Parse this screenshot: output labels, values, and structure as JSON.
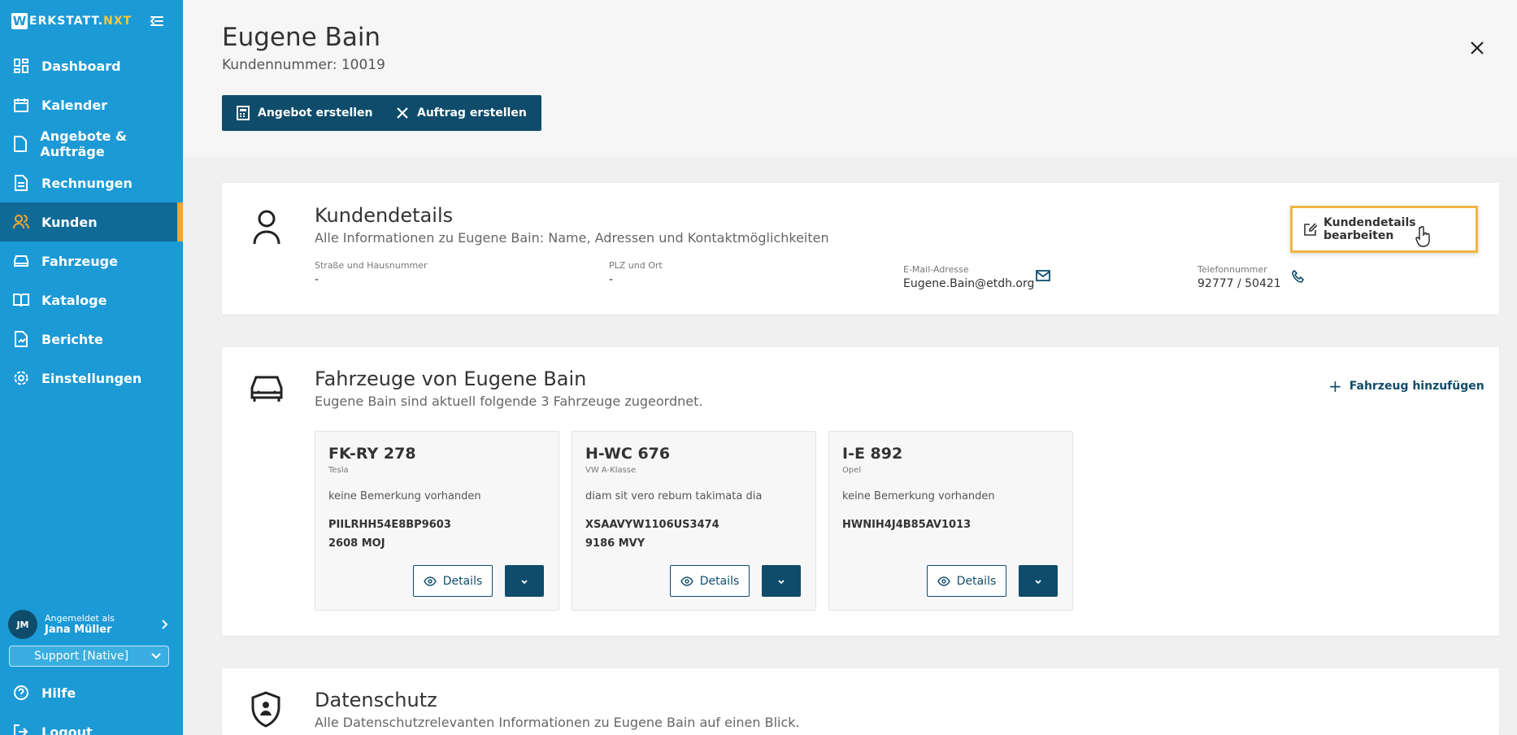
{
  "brand": {
    "w": "W",
    "text": "ERKSTATT.",
    "nxt": "NXT"
  },
  "nav": {
    "items": [
      {
        "label": "Dashboard",
        "icon": "dashboard-icon"
      },
      {
        "label": "Kalender",
        "icon": "calendar-icon"
      },
      {
        "label": "Angebote & Aufträge",
        "icon": "document-icon"
      },
      {
        "label": "Rechnungen",
        "icon": "invoice-icon"
      },
      {
        "label": "Kunden",
        "icon": "users-icon",
        "active": true
      },
      {
        "label": "Fahrzeuge",
        "icon": "car-icon"
      },
      {
        "label": "Kataloge",
        "icon": "book-icon"
      },
      {
        "label": "Berichte",
        "icon": "report-icon"
      },
      {
        "label": "Einstellungen",
        "icon": "gear-icon"
      }
    ],
    "bottom": [
      {
        "label": "Hilfe",
        "icon": "help-icon"
      },
      {
        "label": "Logout",
        "icon": "logout-icon"
      }
    ]
  },
  "user": {
    "initials": "JM",
    "logged_in_as": "Angemeldet als",
    "name": "Jana Müller",
    "role": "Support [Native]"
  },
  "header": {
    "customer_name": "Eugene Bain",
    "customer_number": "Kundennummer: 10019",
    "btn_offer": "Angebot erstellen",
    "btn_order": "Auftrag erstellen"
  },
  "customer_details": {
    "title": "Kundendetails",
    "subtitle": "Alle Informationen zu Eugene Bain: Name, Adressen und Kontaktmöglichkeiten",
    "edit_label": "Kundendetails bearbeiten",
    "street_label": "Straße und Hausnummer",
    "street_value": "-",
    "city_label": "PLZ und Ort",
    "city_value": "-",
    "email_label": "E-Mail-Adresse",
    "email_value": "Eugene.Bain@etdh.org",
    "phone_label": "Telefonnummer",
    "phone_value": "92777 / 50421"
  },
  "vehicles": {
    "title": "Fahrzeuge von Eugene Bain",
    "subtitle": "Eugene Bain sind aktuell folgende 3 Fahrzeuge zugeordnet.",
    "add_label": "Fahrzeug hinzufügen",
    "details_label": "Details",
    "items": [
      {
        "plate": "FK-RY 278",
        "model": "Tesla",
        "remark": "keine Bemerkung vorhanden",
        "vin": "PIILRHH54E8BP9603",
        "kba": "2608 MOJ"
      },
      {
        "plate": "H-WC 676",
        "model": "VW A-Klasse",
        "remark": "diam sit vero rebum takimata dia",
        "vin": "XSAAVYW1106US3474",
        "kba": "9186 MVY"
      },
      {
        "plate": "I-E 892",
        "model": "Opel",
        "remark": "keine Bemerkung vorhanden",
        "vin": "HWNIH4J4B85AV1013",
        "kba": ""
      }
    ]
  },
  "privacy": {
    "title": "Datenschutz",
    "subtitle": "Alle Datenschutzrelevanten Informationen zu Eugene Bain auf einen Blick."
  },
  "colors": {
    "sidebar": "#1b9ad6",
    "sidebar_active": "#0f6a96",
    "primary": "#0f4c6b",
    "accent": "#f0b642"
  }
}
